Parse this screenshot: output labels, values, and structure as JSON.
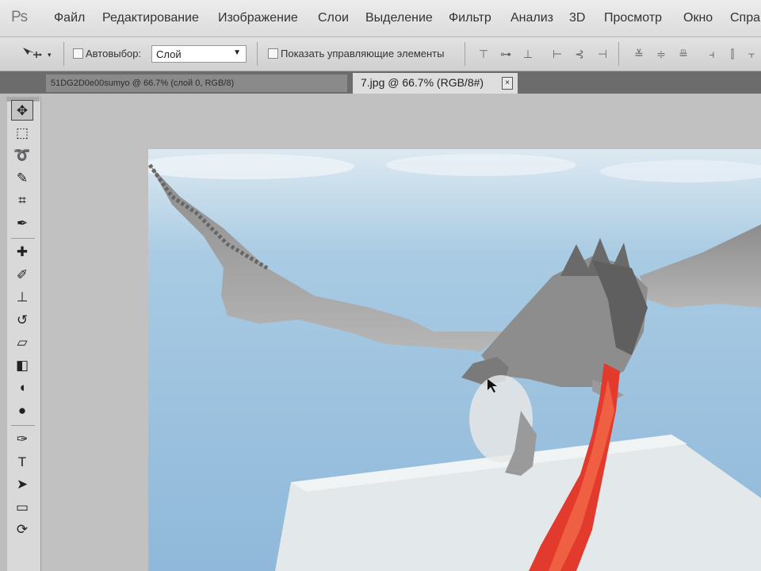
{
  "app": {
    "logo": "Ps"
  },
  "menu": [
    {
      "label": "Файл"
    },
    {
      "label": "Редактирование"
    },
    {
      "label": "Изображение"
    },
    {
      "label": "Слои"
    },
    {
      "label": "Выделение"
    },
    {
      "label": "Фильтр"
    },
    {
      "label": "Анализ"
    },
    {
      "label": "3D"
    },
    {
      "label": "Просмотр"
    },
    {
      "label": "Окно"
    },
    {
      "label": "Спра"
    }
  ],
  "options": {
    "tool_icon": "move-tool-icon",
    "autoselect_label": "Автовыбор:",
    "autoselect_checked": false,
    "autoselect_value": "Слой",
    "show_transform_label": "Показать управляющие элементы",
    "show_transform_checked": false
  },
  "tabs": {
    "inactive_label": "51DG2D0e00sumyo @ 66.7% (слой 0, RGB/8)",
    "active_label": "7.jpg @ 66.7% (RGB/8#)",
    "close_glyph": "×"
  },
  "tools": [
    {
      "name": "move-tool",
      "glyph": "✥",
      "selected": true
    },
    {
      "name": "marquee-tool",
      "glyph": "⬚"
    },
    {
      "name": "lasso-tool",
      "glyph": "➰"
    },
    {
      "name": "quick-selection-tool",
      "glyph": "✎"
    },
    {
      "name": "crop-tool",
      "glyph": "⌗"
    },
    {
      "name": "eyedropper-tool",
      "glyph": "✒"
    },
    {
      "name": "healing-brush-tool",
      "glyph": "✚"
    },
    {
      "name": "brush-tool",
      "glyph": "✐"
    },
    {
      "name": "clone-stamp-tool",
      "glyph": "⊥"
    },
    {
      "name": "history-brush-tool",
      "glyph": "↺"
    },
    {
      "name": "eraser-tool",
      "glyph": "▱"
    },
    {
      "name": "gradient-tool",
      "glyph": "◧"
    },
    {
      "name": "blur-tool",
      "glyph": "◖"
    },
    {
      "name": "dodge-tool",
      "glyph": "●"
    },
    {
      "name": "pen-tool",
      "glyph": "✑"
    },
    {
      "name": "type-tool",
      "glyph": "T"
    },
    {
      "name": "path-selection-tool",
      "glyph": "➤"
    },
    {
      "name": "rectangle-tool",
      "glyph": "▭"
    },
    {
      "name": "3d-rotate-tool",
      "glyph": "⟳"
    }
  ]
}
